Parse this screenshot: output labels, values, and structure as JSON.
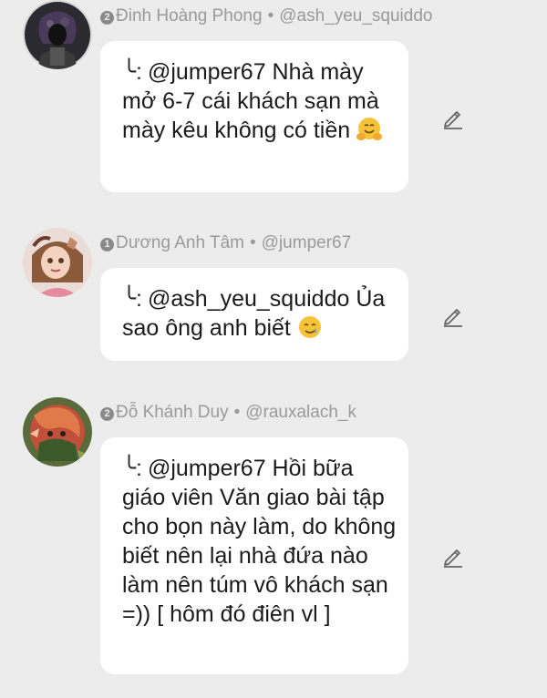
{
  "comments": [
    {
      "rank": "2",
      "name": "Đinh Hoàng Phong",
      "handle": "@ash_yeu_squiddo",
      "reply_mark": "╰:",
      "text": "@jumper67 Nhà mày mở 6-7 cái khách sạn mà mày kêu không có tiền",
      "emoji_icon": "hugging-face-emoji"
    },
    {
      "rank": "1",
      "name": "Dương Anh Tâm",
      "handle": "@jumper67",
      "reply_mark": "╰:",
      "text": "@ash_yeu_squiddo Ủa sao ông anh biết",
      "emoji_icon": "smiling-with-tear-emoji"
    },
    {
      "rank": "2",
      "name": "Đỗ Khánh Duy",
      "handle": "@rauxalach_k",
      "reply_mark": "╰:",
      "text": "@jumper67 Hồi bữa giáo viên Văn giao bài tập cho bọn này làm, do không biết nên lại nhà đứa nào làm nên túm vô khách sạn =)) [ hôm đó điên vl ]"
    }
  ],
  "separator": "•",
  "colors": {
    "background": "#ececec",
    "bubble": "#ffffff",
    "meta_text": "#9a9a9a",
    "body_text": "#1b1b1b"
  }
}
